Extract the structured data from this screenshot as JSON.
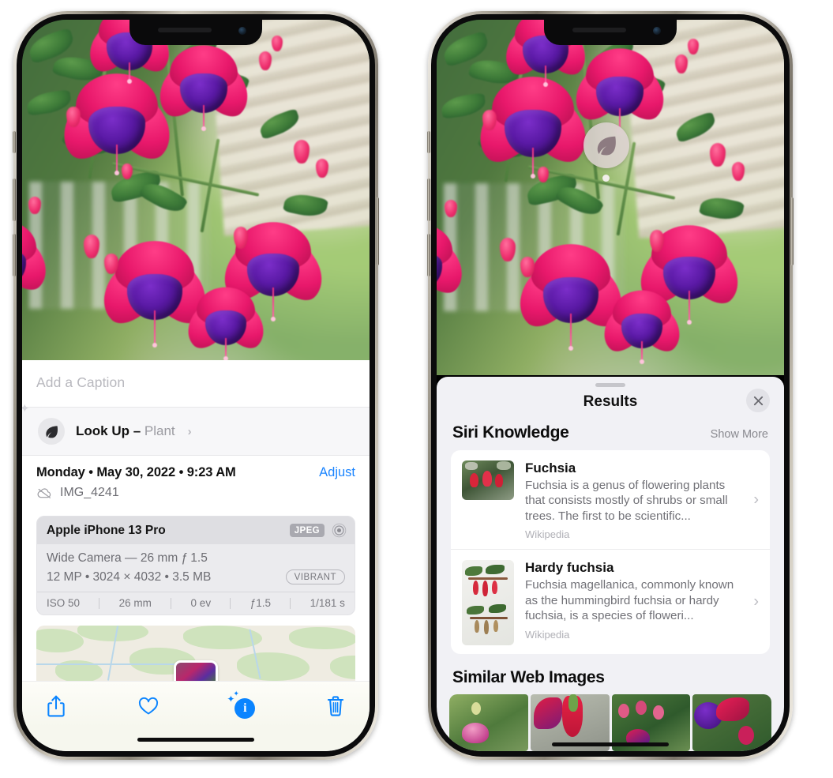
{
  "left_phone": {
    "caption_placeholder": "Add a Caption",
    "lookup": {
      "label": "Look Up – ",
      "subject": "Plant",
      "chevron": "›",
      "icon": "leaf-icon"
    },
    "meta": {
      "date": "Monday • May 30, 2022 • 9:23 AM",
      "adjust_label": "Adjust",
      "filename": "IMG_4241",
      "cloud_icon": "cloud-slash-icon"
    },
    "exif": {
      "model": "Apple iPhone 13 Pro",
      "format_tag": "JPEG",
      "hdr_icon": "hdr-ring-icon",
      "lens_line": "Wide Camera — 26 mm ƒ 1.5",
      "size_line": "12 MP • 3024 × 4032 • 3.5 MB",
      "style_tag": "VIBRANT",
      "settings": [
        "ISO 50",
        "26 mm",
        "0 ev",
        "ƒ1.5",
        "1/181 s"
      ]
    },
    "toolbar": {
      "share_label": "share-icon",
      "favorite_label": "heart-icon",
      "info_label": "i",
      "delete_label": "trash-icon"
    }
  },
  "right_phone": {
    "bubble_icon": "leaf-icon",
    "sheet": {
      "title": "Results",
      "close_label": "close-icon",
      "siri_section": {
        "heading": "Siri Knowledge",
        "show_more": "Show More",
        "cards": [
          {
            "title": "Fuchsia",
            "desc": "Fuchsia is a genus of flowering plants that consists mostly of shrubs or small trees. The first to be scientific...",
            "source": "Wikipedia",
            "chevron": "›"
          },
          {
            "title": "Hardy fuchsia",
            "desc": "Fuchsia magellanica, commonly known as the hummingbird fuchsia or hardy fuchsia, is a species of floweri...",
            "source": "Wikipedia",
            "chevron": "›"
          }
        ]
      },
      "web_section": {
        "heading": "Similar Web Images",
        "thumbnails": [
          "web-image-1",
          "web-image-2",
          "web-image-3",
          "web-image-4"
        ]
      }
    }
  },
  "colors": {
    "accent_blue": "#0a84ff",
    "link_blue": "#1a84ff",
    "sheet_bg": "#f1f1f5",
    "card_bg": "#ffffff",
    "muted_text": "#717177"
  }
}
